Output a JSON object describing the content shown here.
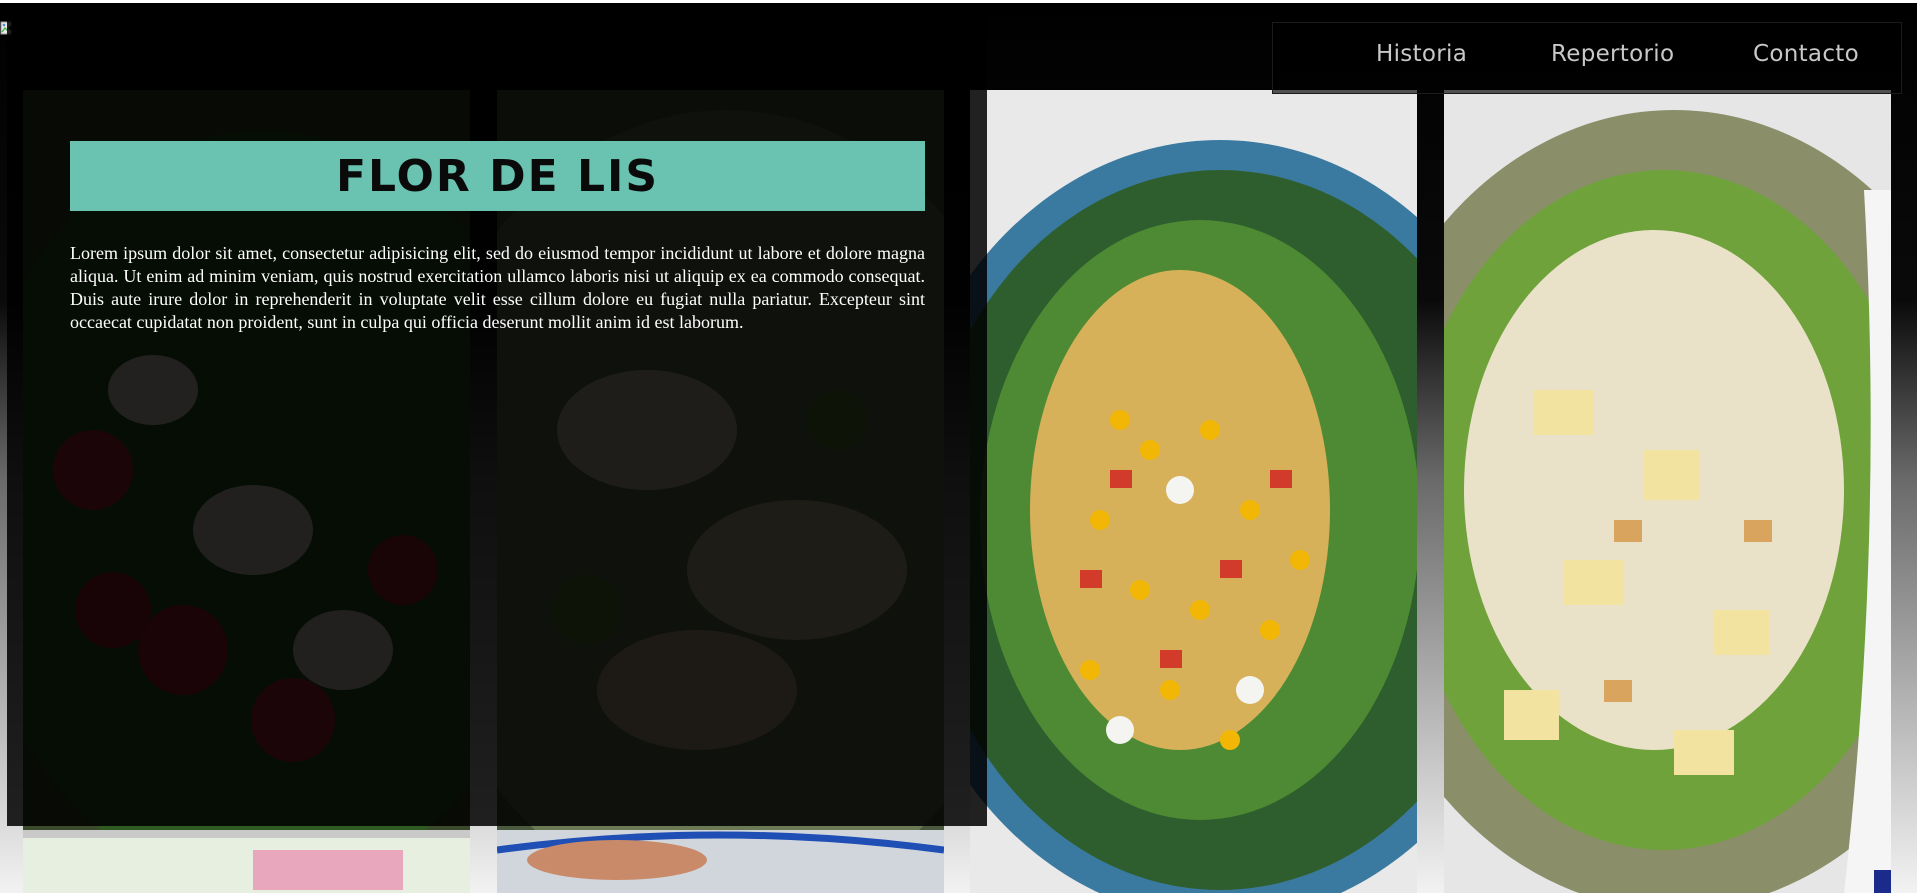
{
  "nav": {
    "items": [
      {
        "label": "Historia"
      },
      {
        "label": "Repertorio"
      },
      {
        "label": "Contacto"
      }
    ]
  },
  "hero": {
    "title": "FLOR DE LIS",
    "body": "Lorem ipsum dolor sit amet, consectetur adipisicing elit, sed do eiusmod tempor incididunt ut labore et dolore magna aliqua. Ut enim ad minim veniam, quis nostrud exercitation ullamco laboris nisi ut aliquip ex ea commodo consequat. Duis aute irure dolor in reprehenderit in voluptate velit esse cillum dolore eu fugiat nulla pariatur. Excepteur sint occaecat cupidatat non proident, sunt in culpa qui officia deserunt mollit anim id est laborum."
  },
  "gallery": {
    "images": [
      {
        "name": "salad-berries-image"
      },
      {
        "name": "salad-chicken-image"
      },
      {
        "name": "salad-corn-image"
      },
      {
        "name": "salad-caesar-image"
      }
    ]
  },
  "colors": {
    "accent": "#6ac3b0",
    "overlay": "#000000",
    "nav_text": "#c8c8c8"
  }
}
